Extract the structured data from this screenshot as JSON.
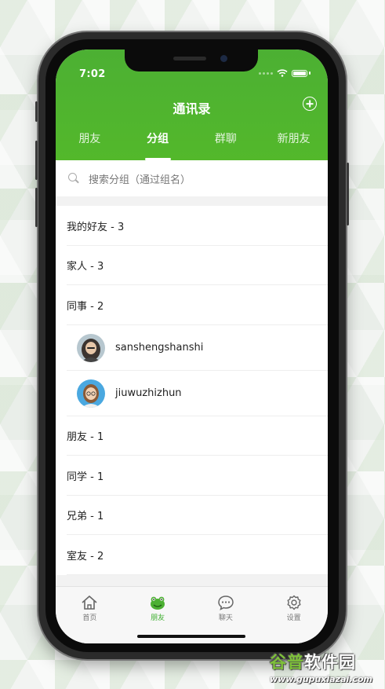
{
  "status_bar": {
    "time": "7:02"
  },
  "header": {
    "title": "通讯录",
    "tabs": [
      {
        "label": "朋友",
        "active": false
      },
      {
        "label": "分组",
        "active": true
      },
      {
        "label": "群聊",
        "active": false
      },
      {
        "label": "新朋友",
        "active": false
      }
    ]
  },
  "search": {
    "placeholder": "搜索分组（通过组名）"
  },
  "groups": {
    "g1": "我的好友 - 3",
    "g2": "家人 - 3",
    "g3": "同事 - 2",
    "members": [
      {
        "name": "sanshengshanshi",
        "avatar": "avatar-dark-hair"
      },
      {
        "name": "jiuwuzhizhun",
        "avatar": "avatar-glasses"
      }
    ],
    "g4": "朋友 - 1",
    "g5": "同学 - 1",
    "g6": "兄弟 - 1",
    "g7": "室友 - 2"
  },
  "tabbar": {
    "items": [
      {
        "label": "首页",
        "icon": "home-icon",
        "active": false
      },
      {
        "label": "朋友",
        "icon": "frog-icon",
        "active": true
      },
      {
        "label": "聊天",
        "icon": "chat-bubble-icon",
        "active": false
      },
      {
        "label": "设置",
        "icon": "gear-icon",
        "active": false
      }
    ]
  },
  "watermark": {
    "title_a": "谷普",
    "title_b": "软件园",
    "url": "www.gupuxiazai.com"
  },
  "colors": {
    "brand_green": "#4cb033",
    "active_tab_green": "#3cae2d"
  }
}
